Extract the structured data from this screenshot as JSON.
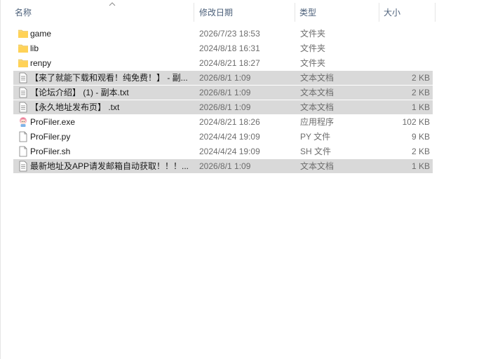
{
  "columns": {
    "name": "名称",
    "date": "修改日期",
    "type": "类型",
    "size": "大小"
  },
  "files": [
    {
      "name": "game",
      "date": "2026/7/23 18:53",
      "type": "文件夹",
      "size": "",
      "icon": "folder-icon",
      "selected": false
    },
    {
      "name": "lib",
      "date": "2024/8/18 16:31",
      "type": "文件夹",
      "size": "",
      "icon": "folder-icon",
      "selected": false
    },
    {
      "name": "renpy",
      "date": "2024/8/21 18:27",
      "type": "文件夹",
      "size": "",
      "icon": "folder-icon",
      "selected": false
    },
    {
      "name": "【来了就能下载和观看！纯免费！】 - 副...",
      "date": "2026/8/1 1:09",
      "type": "文本文档",
      "size": "2 KB",
      "icon": "text-file-icon",
      "selected": true
    },
    {
      "name": "【论坛介绍】 (1) - 副本.txt",
      "date": "2026/8/1 1:09",
      "type": "文本文档",
      "size": "2 KB",
      "icon": "text-file-icon",
      "selected": true
    },
    {
      "name": "【永久地址发布页】 .txt",
      "date": "2026/8/1 1:09",
      "type": "文本文档",
      "size": "1 KB",
      "icon": "text-file-icon",
      "selected": true
    },
    {
      "name": "ProFiler.exe",
      "date": "2024/8/21 18:26",
      "type": "应用程序",
      "size": "102 KB",
      "icon": "app-exe-icon",
      "selected": false
    },
    {
      "name": "ProFiler.py",
      "date": "2024/4/24 19:09",
      "type": "PY 文件",
      "size": "9 KB",
      "icon": "blank-file-icon",
      "selected": false
    },
    {
      "name": "ProFiler.sh",
      "date": "2024/4/24 19:09",
      "type": "SH 文件",
      "size": "2 KB",
      "icon": "blank-file-icon",
      "selected": false
    },
    {
      "name": "最新地址及APP请发邮箱自动获取！！！...",
      "date": "2026/8/1 1:09",
      "type": "文本文档",
      "size": "1 KB",
      "icon": "text-file-icon",
      "selected": true
    }
  ]
}
